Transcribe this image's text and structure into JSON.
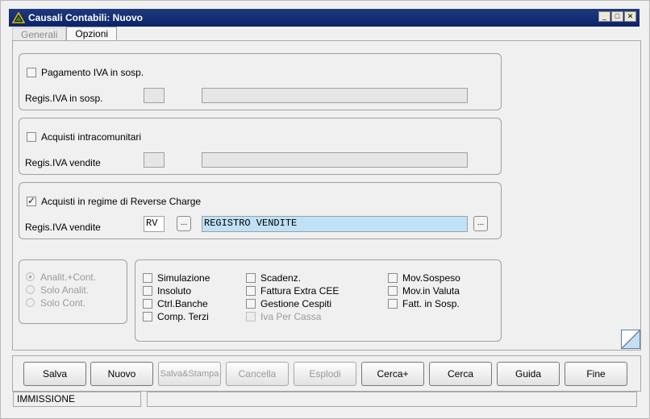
{
  "window": {
    "title": "Causali Contabili: Nuovo",
    "controls": {
      "minimize": "_",
      "maximize": "□",
      "close": "✕"
    }
  },
  "tabs": [
    {
      "label": "Generali",
      "active": false
    },
    {
      "label": "Opzioni",
      "active": true
    }
  ],
  "group_iva_sosp": {
    "checkbox_label": "Pagamento IVA in sosp.",
    "checked": false,
    "field_label": "Regis.IVA in sosp.",
    "code": "",
    "description": ""
  },
  "group_intracom": {
    "checkbox_label": "Acquisti intracomunitari",
    "checked": false,
    "field_label": "Regis.IVA vendite",
    "code": "",
    "description": ""
  },
  "group_reverse": {
    "checkbox_label": "Acquisti in regime di Reverse Charge",
    "checked": true,
    "field_label": "Regis.IVA vendite",
    "code": "RV",
    "description": "REGISTRO VENDITE",
    "lookup_label": "...",
    "lookup2_label": "..."
  },
  "radio_group": {
    "options": [
      {
        "label": "Analit.+Cont.",
        "selected": true
      },
      {
        "label": "Solo Analit.",
        "selected": false
      },
      {
        "label": "Solo Cont.",
        "selected": false
      }
    ]
  },
  "options": {
    "simulazione": {
      "label": "Simulazione",
      "checked": false
    },
    "insoluto": {
      "label": "Insoluto",
      "checked": false
    },
    "ctrl_banche": {
      "label": "Ctrl.Banche",
      "checked": false
    },
    "comp_terzi": {
      "label": "Comp. Terzi",
      "checked": false
    },
    "scadenz": {
      "label": "Scadenz.",
      "checked": false
    },
    "fattura_extra_cee": {
      "label": "Fattura Extra CEE",
      "checked": false
    },
    "gestione_cespiti": {
      "label": "Gestione Cespiti",
      "checked": false
    },
    "iva_per_cassa": {
      "label": "Iva Per Cassa",
      "checked": false,
      "disabled": true
    },
    "mov_sospeso": {
      "label": "Mov.Sospeso",
      "checked": false
    },
    "mov_in_valuta": {
      "label": "Mov.in Valuta",
      "checked": false
    },
    "fatt_in_sosp": {
      "label": "Fatt. in Sosp.",
      "checked": false
    }
  },
  "buttons": {
    "salva": "Salva",
    "nuovo": "Nuovo",
    "salva_stampa": "Salva&Stampa",
    "cancella": "Cancella",
    "esplodi": "Esplodi",
    "cerca_plus": "Cerca+",
    "cerca": "Cerca",
    "guida": "Guida",
    "fine": "Fine"
  },
  "status": {
    "mode": "IMMISSIONE",
    "message": ""
  }
}
